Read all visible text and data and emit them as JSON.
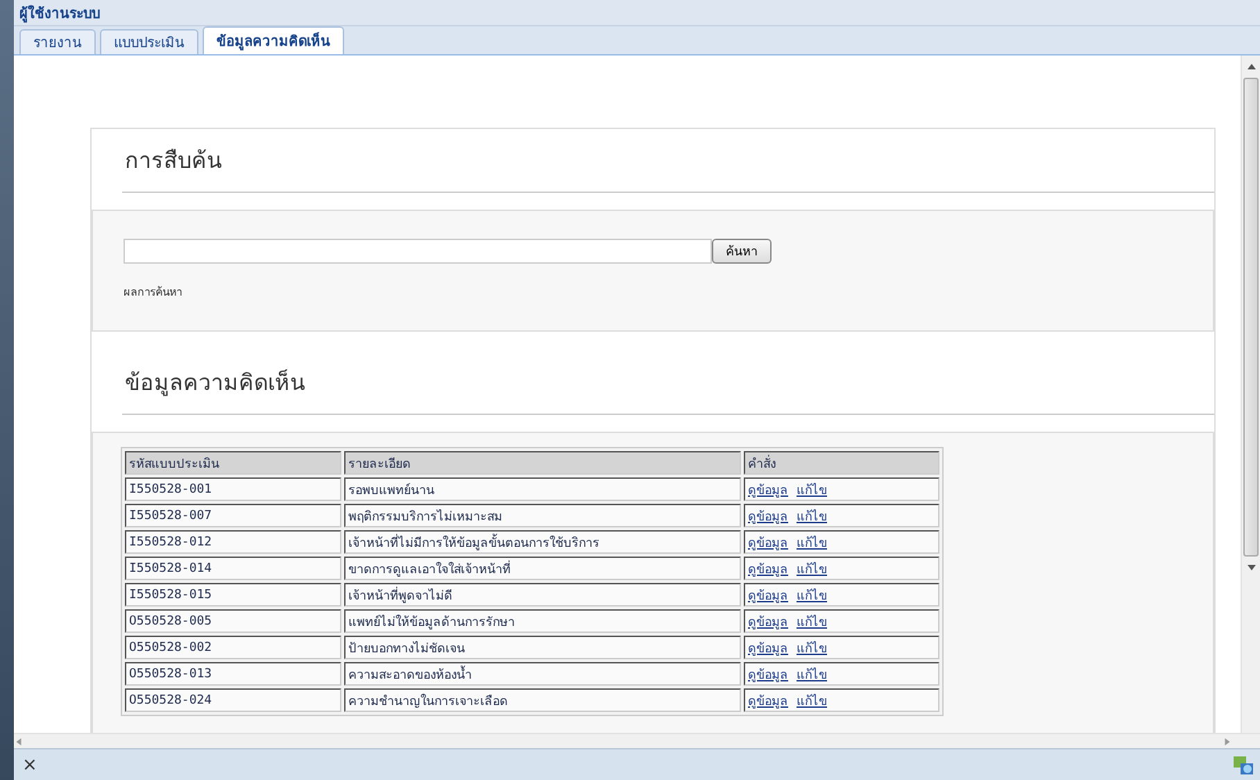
{
  "window": {
    "title": "ผู้ใช้งานระบบ"
  },
  "tabs": [
    {
      "label": "รายงาน",
      "selected": false
    },
    {
      "label": "แบบประเมิน",
      "selected": false
    },
    {
      "label": "ข้อมูลความคิดเห็น",
      "selected": true
    }
  ],
  "search_section": {
    "heading": "การสืบค้น",
    "button": "ค้นหา",
    "result_label": "ผลการค้นหา"
  },
  "comments_section": {
    "heading": "ข้อมูลความคิดเห็น",
    "table": {
      "columns": [
        "รหัสแบบประเมิน",
        "รายละเอียด",
        "คำสั่ง"
      ],
      "rows": [
        {
          "code": "I550528-001",
          "detail": "รอพบแพทย์นาน",
          "actions": [
            "ดูข้อมูล",
            "แก้ไข"
          ]
        },
        {
          "code": "I550528-007",
          "detail": "พฤติกรรมบริการไม่เหมาะสม",
          "actions": [
            "ดูข้อมูล",
            "แก้ไข"
          ]
        },
        {
          "code": "I550528-012",
          "detail": "เจ้าหน้าที่ไม่มีการให้ข้อมูลขั้นตอนการใช้บริการ",
          "actions": [
            "ดูข้อมูล",
            "แก้ไข"
          ]
        },
        {
          "code": "I550528-014",
          "detail": "ขาดการดูแลเอาใจใส่เจ้าหน้าที่",
          "actions": [
            "ดูข้อมูล",
            "แก้ไข"
          ]
        },
        {
          "code": "I550528-015",
          "detail": "เจ้าหน้าที่พูดจาไม่ดี",
          "actions": [
            "ดูข้อมูล",
            "แก้ไข"
          ]
        },
        {
          "code": "O550528-005",
          "detail": "แพทย์ไม่ให้ข้อมูลด้านการรักษา",
          "actions": [
            "ดูข้อมูล",
            "แก้ไข"
          ]
        },
        {
          "code": "O550528-002",
          "detail": "ป้ายบอกทางไม่ชัดเจน",
          "actions": [
            "ดูข้อมูล",
            "แก้ไข"
          ]
        },
        {
          "code": "O550528-013",
          "detail": "ความสะอาดของห้องน้ำ",
          "actions": [
            "ดูข้อมูล",
            "แก้ไข"
          ]
        },
        {
          "code": "O550528-024",
          "detail": "ความชำนาญในการเจาะเลือด",
          "actions": [
            "ดูข้อมูล",
            "แก้ไข"
          ]
        }
      ]
    }
  },
  "status_bar": {
    "close": "×"
  }
}
